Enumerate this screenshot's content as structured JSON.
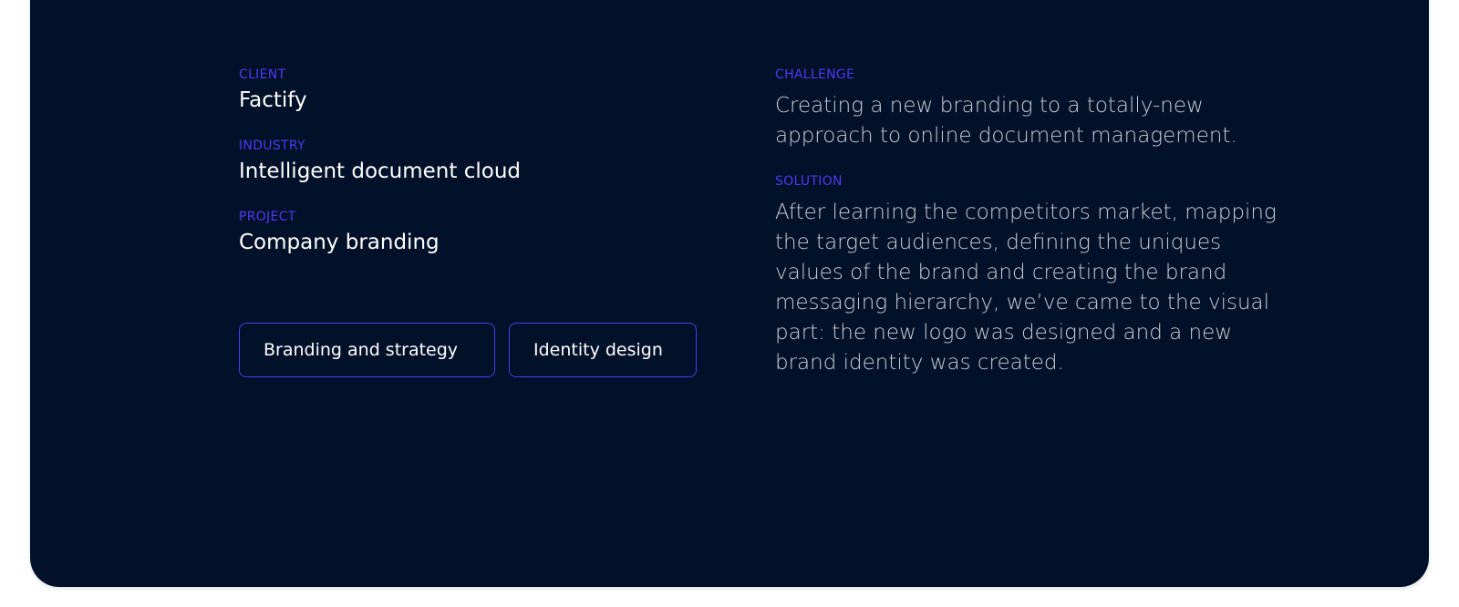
{
  "details": {
    "client_label": "CLIENT",
    "client_value": "Factify",
    "industry_label": "INDUSTRY",
    "industry_value": "Intelligent document cloud",
    "project_label": "PROJECT",
    "project_value": "Company branding"
  },
  "tags": [
    {
      "label": "Branding and strategy"
    },
    {
      "label": "Identity design"
    }
  ],
  "challenge": {
    "label": "CHALLENGE",
    "text": "Creating a new branding to a totally-new approach to online document management."
  },
  "solution": {
    "label": "SOLUTION",
    "text": "After learning the competitors market, mapping the target audiences, defining the uniques values of the brand and creating the brand messaging hierarchy, we’ve came to the visual part: the new logo was designed and a new brand identity was created."
  },
  "colors": {
    "card_background": "#02112a",
    "accent": "#4a3cf0",
    "text_primary": "#ffffff",
    "text_secondary": "#c9ccd8"
  }
}
